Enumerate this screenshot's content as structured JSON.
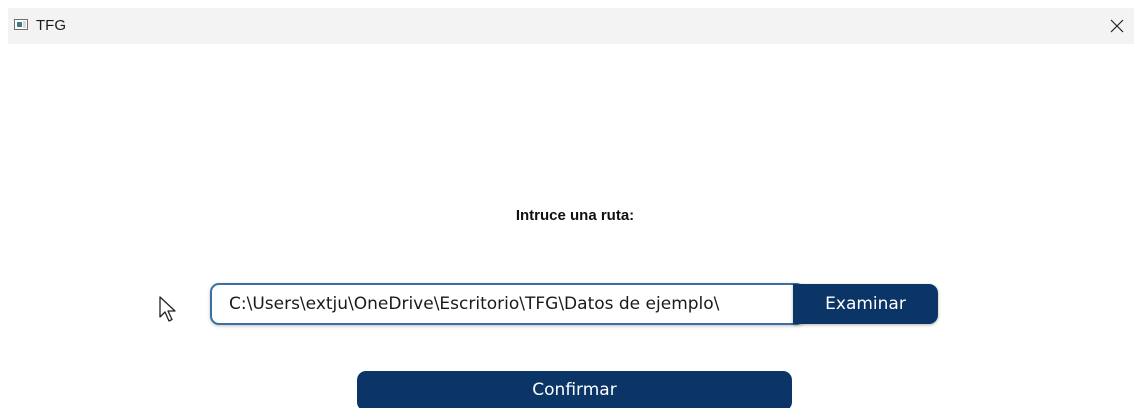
{
  "window": {
    "title": "TFG",
    "icons": {
      "app": "app-window-icon",
      "close": "close-icon",
      "cursor": "mouse-pointer-icon"
    }
  },
  "form": {
    "prompt_label": "Intruce una ruta:",
    "path_value": "C:\\Users\\extju\\OneDrive\\Escritorio\\TFG\\Datos de ejemplo\\",
    "browse_label": "Examinar",
    "confirm_label": "Confirmar"
  },
  "colors": {
    "primary": "#0b3566",
    "input_border": "#3a6ea5",
    "titlebar": "#f3f3f3"
  }
}
